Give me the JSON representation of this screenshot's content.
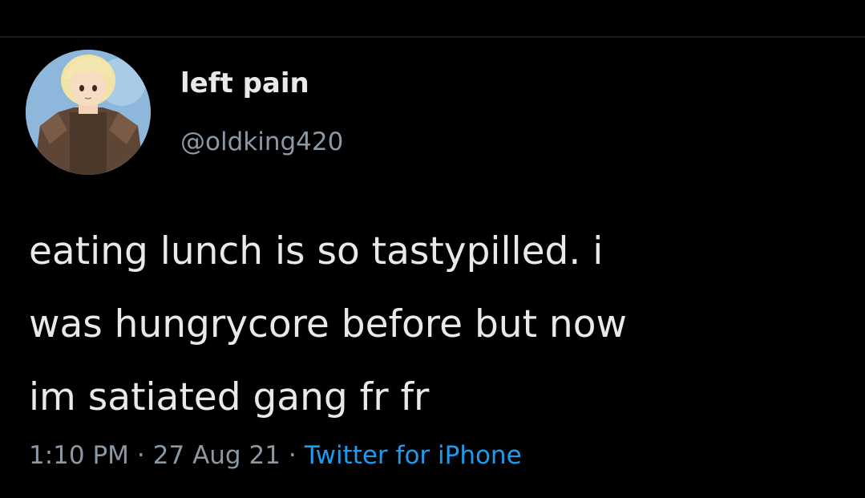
{
  "tweet": {
    "display_name": "left pain",
    "handle": "@oldking420",
    "text_lines": [
      "eating lunch is so tastypilled. i",
      "was hungrycore before but now",
      "im satiated gang fr fr"
    ],
    "time": "1:10 PM",
    "separator": "·",
    "date": "27 Aug 21",
    "source": "Twitter for iPhone"
  },
  "colors": {
    "background": "#000000",
    "primary_text": "#e7e9ea",
    "secondary_text": "#8b98a5",
    "link": "#1d9bf0"
  },
  "icons": {
    "avatar": "anime-knight-avatar"
  }
}
